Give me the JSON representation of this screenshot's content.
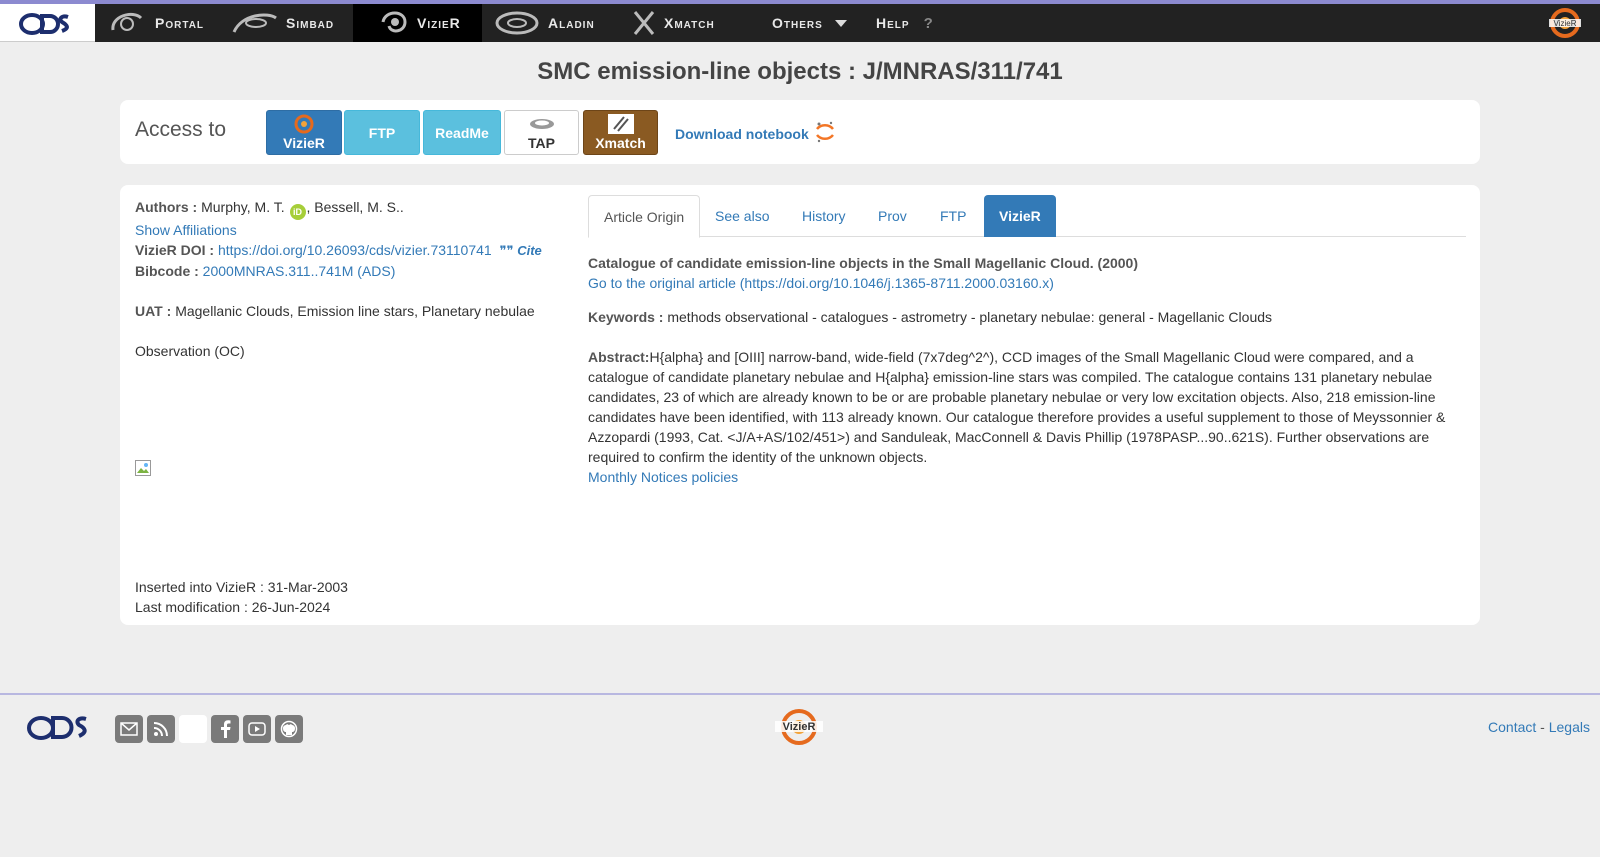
{
  "nav": {
    "portal": "Portal",
    "simbad": "Simbad",
    "vizier": "VizieR",
    "aladin": "Aladin",
    "xmatch": "Xmatch",
    "others": "Others",
    "help": "Help",
    "help_mark": "?"
  },
  "title": "SMC emission-line objects : J/MNRAS/311/741",
  "access": {
    "label": "Access to",
    "buttons": {
      "vizier": "VizieR",
      "ftp": "FTP",
      "readme": "ReadMe",
      "tap": "TAP",
      "xmatch": "Xmatch"
    },
    "notebook": "Download notebook"
  },
  "meta": {
    "authors_label": "Authors :",
    "author1": "Murphy, M. T.",
    "author2": ", Bessell, M. S..",
    "show_affiliations": "Show Affiliations",
    "doi_label": "VizieR DOI :",
    "doi": "https://doi.org/10.26093/cds/vizier.73110741",
    "cite": "Cite",
    "bibcode_label": "Bibcode :",
    "bibcode": "2000MNRAS.311..741M (ADS)",
    "uat_label": "UAT :",
    "uat": "Magellanic Clouds, Emission line stars, Planetary nebulae",
    "observation": "Observation (OC)",
    "inserted": "Inserted into VizieR : 31-Mar-2003",
    "modified": "Last modification : 26-Jun-2024"
  },
  "tabs": [
    "Article Origin",
    "See also",
    "History",
    "Prov",
    "FTP",
    "VizieR"
  ],
  "article": {
    "title": "Catalogue of candidate emission-line objects in the Small Magellanic Cloud. (2000)",
    "link": "Go to the original article (https://doi.org/10.1046/j.1365-8711.2000.03160.x)",
    "keywords_label": "Keywords :",
    "keywords": "methods observational - catalogues - astrometry - planetary nebulae: general - Magellanic Clouds",
    "abstract_label": "Abstract:",
    "abstract": "H{alpha} and [OIII] narrow-band, wide-field (7x7deg^2^), CCD images of the Small Magellanic Cloud were compared, and a catalogue of candidate planetary nebulae and H{alpha} emission-line stars was compiled. The catalogue contains 131 planetary nebulae candidates, 23 of which are already known to be or are probable planetary nebulae or very low excitation objects. Also, 218 emission-line candidates have been identified, with 113 already known. Our catalogue therefore provides a useful supplement to those of Meyssonnier & Azzopardi (1993, Cat. <J/A+AS/102/451>) and Sanduleak, MacConnell & Davis Phillip (1978PASP...90..621S). Further observations are required to confirm the identity of the unknown objects.",
    "policies": "Monthly Notices policies"
  },
  "footer": {
    "contact": "Contact",
    "sep": " - ",
    "legals": "Legals"
  },
  "colors": {
    "nav_bg": "#222222",
    "nav_accent": "#8c8ad0",
    "primary": "#337ab7",
    "info": "#5bc0de",
    "xmatch": "#8a5a22",
    "orcid": "#a6ce39"
  }
}
